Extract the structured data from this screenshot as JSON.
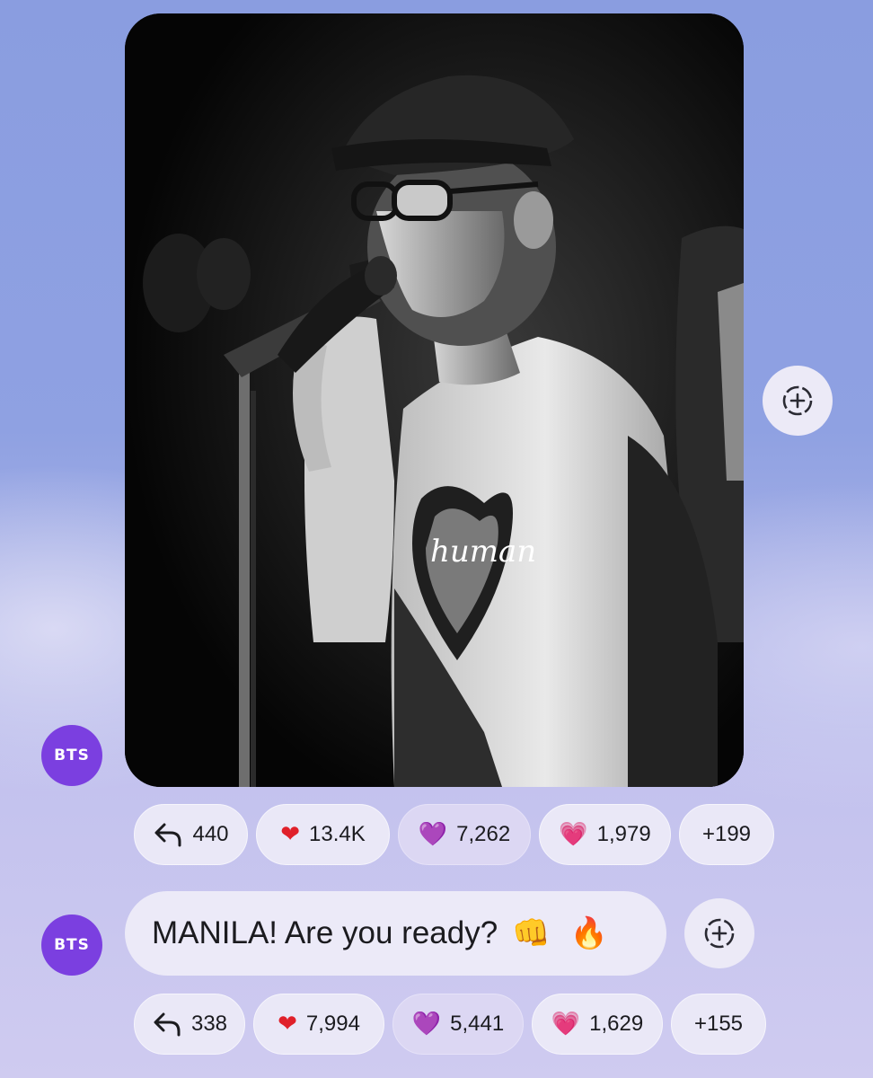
{
  "post1": {
    "avatar_label": "BTS",
    "reactions": [
      {
        "icon": "reply-icon",
        "emoji": "",
        "count": "440",
        "selected": false
      },
      {
        "icon": "red-heart-icon",
        "emoji": "❤",
        "count": "13.4K",
        "selected": false
      },
      {
        "icon": "purple-heart-icon",
        "emoji": "💜",
        "count": "7,262",
        "selected": true
      },
      {
        "icon": "pink-heart-icon",
        "emoji": "💗",
        "count": "1,979",
        "selected": false
      },
      {
        "icon": "",
        "emoji": "",
        "count": "+199",
        "selected": false
      }
    ]
  },
  "post2": {
    "avatar_label": "BTS",
    "message": "MANILA! Are you ready?",
    "message_emojis": [
      "👊",
      "🔥"
    ],
    "reactions": [
      {
        "icon": "reply-icon",
        "emoji": "",
        "count": "338",
        "selected": false
      },
      {
        "icon": "red-heart-icon",
        "emoji": "❤",
        "count": "7,994",
        "selected": false
      },
      {
        "icon": "purple-heart-icon",
        "emoji": "💜",
        "count": "5,441",
        "selected": true
      },
      {
        "icon": "pink-heart-icon",
        "emoji": "💗",
        "count": "1,629",
        "selected": false
      },
      {
        "icon": "",
        "emoji": "",
        "count": "+155",
        "selected": false
      }
    ]
  },
  "colors": {
    "avatar": "#7b3fe0",
    "heart_red": "#e0202a",
    "heart_purple": "#9b4fd6",
    "heart_pink": "#f36aa8"
  }
}
